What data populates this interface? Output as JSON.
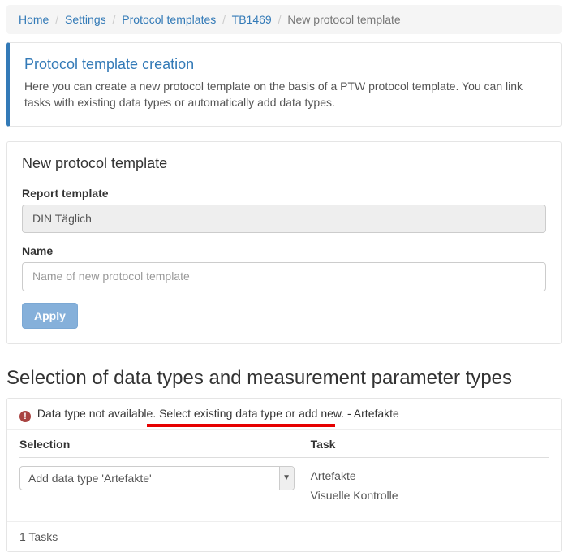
{
  "breadcrumb": {
    "items": [
      {
        "label": "Home",
        "link": true
      },
      {
        "label": "Settings",
        "link": true
      },
      {
        "label": "Protocol templates",
        "link": true
      },
      {
        "label": "TB1469",
        "link": true
      },
      {
        "label": "New protocol template",
        "link": false
      }
    ]
  },
  "callout": {
    "title": "Protocol template creation",
    "text": "Here you can create a new protocol template on the basis of a PTW protocol template. You can link tasks with existing data types or automatically add data types."
  },
  "form": {
    "heading": "New protocol template",
    "report_template_label": "Report template",
    "report_template_value": "DIN Täglich",
    "name_label": "Name",
    "name_placeholder": "Name of new protocol template",
    "name_value": "",
    "apply_label": "Apply"
  },
  "section_title": "Selection of data types and measurement parameter types",
  "alert": {
    "text": "Data type not available. Select existing data type or add new. - Artefakte"
  },
  "table": {
    "col_selection": "Selection",
    "col_task": "Task",
    "select_current": "Add data type 'Artefakte'",
    "tasks": [
      "Artefakte",
      "Visuelle Kontrolle"
    ]
  },
  "footer": "1 Tasks"
}
